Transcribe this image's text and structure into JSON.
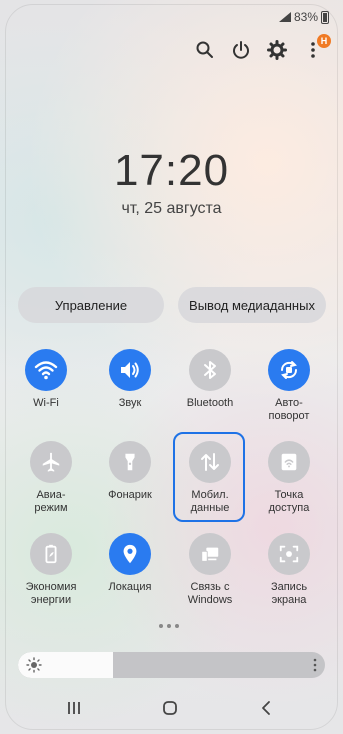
{
  "status": {
    "battery": "83%"
  },
  "top_icons": {
    "notification_badge": "Н"
  },
  "clock": {
    "time": "17:20",
    "date": "чт, 25 августа"
  },
  "buttons": {
    "manage": "Управление",
    "media_output": "Вывод медиаданных"
  },
  "tiles": [
    {
      "label": "Wi-Fi",
      "state": "on",
      "icon": "wifi-icon"
    },
    {
      "label": "Звук",
      "state": "on",
      "icon": "sound-icon"
    },
    {
      "label": "Bluetooth",
      "state": "off",
      "icon": "bluetooth-icon"
    },
    {
      "label": "Авто-\nповорот",
      "state": "on",
      "icon": "auto-rotate-icon"
    },
    {
      "label": "Авиа-\nрежим",
      "state": "off",
      "icon": "airplane-icon"
    },
    {
      "label": "Фонарик",
      "state": "off",
      "icon": "flashlight-icon"
    },
    {
      "label": "Мобил.\nданные",
      "state": "off",
      "icon": "mobile-data-icon"
    },
    {
      "label": "Точка\nдоступа",
      "state": "off",
      "icon": "hotspot-icon"
    },
    {
      "label": "Экономия\nэнергии",
      "state": "off",
      "icon": "power-saving-icon"
    },
    {
      "label": "Локация",
      "state": "on",
      "icon": "location-icon"
    },
    {
      "label": "Связь с\nWindows",
      "state": "off",
      "icon": "link-to-windows-icon"
    },
    {
      "label": "Запись\nэкрана",
      "state": "off",
      "icon": "screen-record-icon"
    }
  ],
  "brightness": {
    "level": 0.31
  },
  "colors": {
    "accent": "#2a7bf0",
    "highlight": "#1e72e6",
    "badge": "#f07a24"
  }
}
